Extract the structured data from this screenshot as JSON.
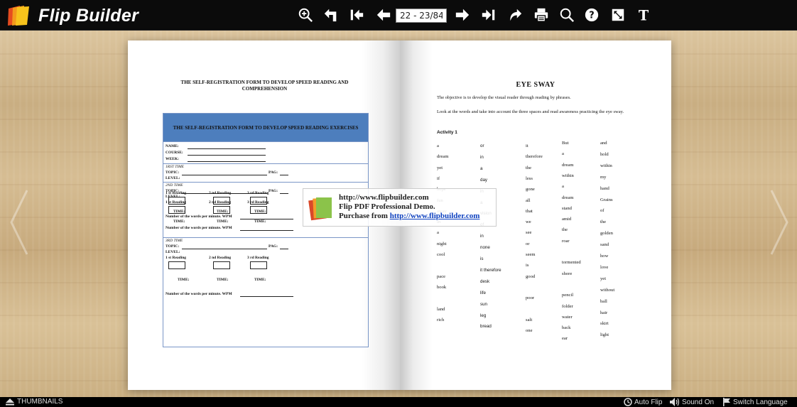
{
  "app": {
    "title": "Flip Builder"
  },
  "toolbar": {
    "page_indicator": "22 - 23/84",
    "buttons": [
      "zoom-in-icon",
      "back-icon",
      "first-page-icon",
      "previous-page-icon",
      "next-page-icon",
      "last-page-icon",
      "share-icon",
      "print-icon",
      "search-icon",
      "help-icon",
      "fullscreen-icon",
      "text-icon"
    ]
  },
  "left_page": {
    "title": "THE SELF-REGISTRATION FORM TO DEVELOP SPEED READING AND COMPREHENSION",
    "form": {
      "header": "THE SELF-REGISTRATION FORM TO DEVELOP SPEED READING EXERCISES",
      "name": "NAME:",
      "course": "COURSE:",
      "week": "WEEK:",
      "s1": "1RST TIME",
      "s2": "2ND TIME",
      "s3": "3RD TIME",
      "topic": "TOPIC:",
      "pag": "PAG:",
      "level": "LEVEL:",
      "r1": "1 st Reading",
      "r2": "2 nd Reading",
      "r3": "3 rd Reading",
      "time": "TIME:",
      "wpm": "Number of the words per minute. WPM"
    }
  },
  "watermark": {
    "line1": "http://www.flipbuilder.com",
    "line2": "Flip PDF Professional Demo.",
    "line3_prefix": "Purchase from ",
    "line3_link": "http://www.flipbuilder.com"
  },
  "right_page": {
    "title": "EYE SWAY",
    "p1": "The objective is to develop the visual reader through reading by phrases.",
    "p2": "Look at the words and take into account the three spaces and read awareness practicing the eye sway.",
    "activity": "Activity 1",
    "col1": [
      "a",
      "dream",
      "yet",
      "if",
      "hope",
      "fun",
      "away",
      "in",
      "a",
      "night",
      "cool",
      "",
      "pace",
      "book",
      "",
      "land",
      "rich"
    ],
    "col2": [
      "or",
      "in",
      "a",
      "day",
      "in",
      "a",
      "vision",
      "of",
      "in",
      "none",
      "is",
      "it therefore",
      "desk",
      "life",
      "sun",
      "leg",
      "bread"
    ],
    "col3": [
      "it",
      "therefore",
      "the",
      "less",
      "gone",
      "all",
      "that",
      "we",
      "see",
      "or",
      "seem",
      "is",
      "good",
      "",
      "poor",
      "",
      "salt",
      "one"
    ],
    "col4": [
      "But",
      "a",
      "dream",
      "within",
      "a",
      "dream",
      "stand",
      "amid",
      "the",
      "roar",
      "",
      "tormented",
      "shore",
      "",
      "pencil",
      "folder",
      "water",
      "back",
      "ear"
    ],
    "col5": [
      "and",
      "hold",
      "within",
      "my",
      "hand",
      "Grains",
      "of",
      "the",
      "golden",
      "sand",
      "how",
      "love",
      "yet",
      "without",
      "ball",
      "hair",
      "skirt",
      "light"
    ]
  },
  "bottom": {
    "thumbnails": "THUMBNAILS",
    "autoflip": "Auto Flip",
    "sound": "Sound On",
    "language": "Switch Language"
  }
}
